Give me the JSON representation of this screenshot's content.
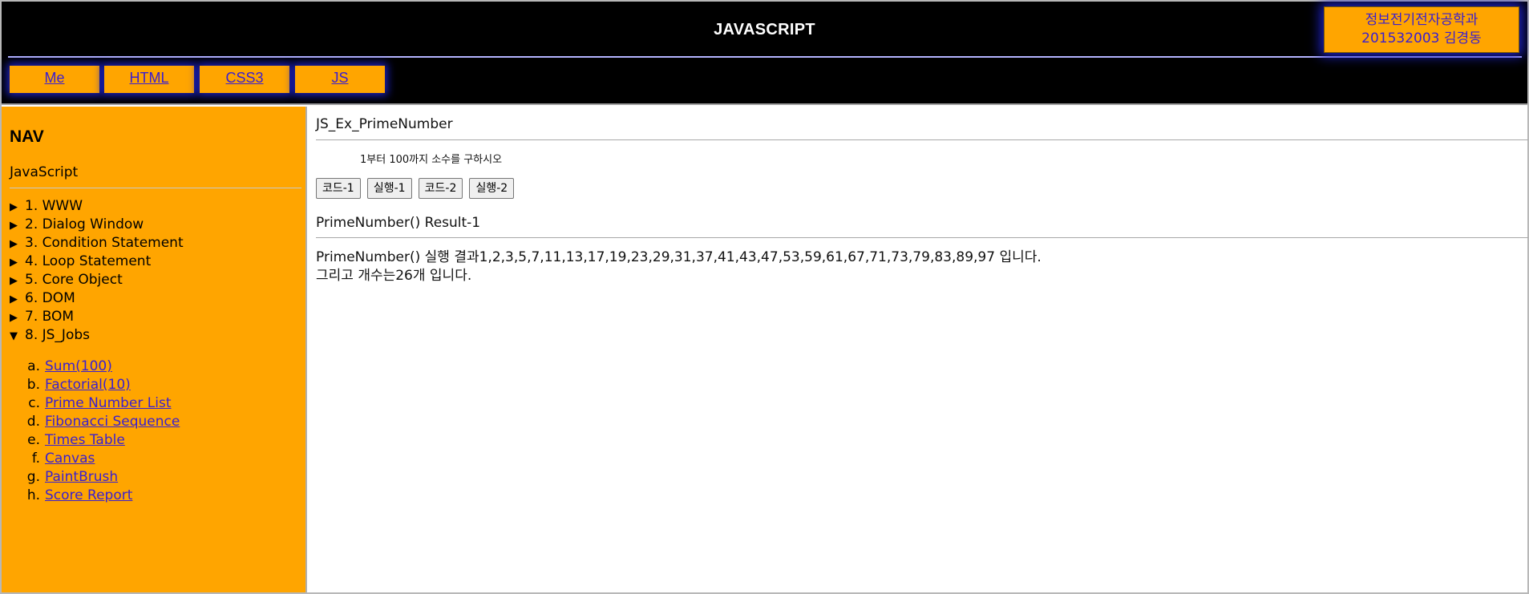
{
  "header": {
    "title": "JAVASCRIPT",
    "badge": {
      "line1": "정보전기전자공학과",
      "line2": "201532003 김경동"
    },
    "nav": [
      {
        "label": "Me"
      },
      {
        "label": "HTML"
      },
      {
        "label": "CSS3"
      },
      {
        "label": "JS"
      }
    ]
  },
  "sidebar": {
    "heading": "NAV",
    "subheading": "JavaScript",
    "chapters": [
      {
        "marker": "▶",
        "label": "1. WWW"
      },
      {
        "marker": "▶",
        "label": "2. Dialog Window"
      },
      {
        "marker": "▶",
        "label": "3. Condition Statement"
      },
      {
        "marker": "▶",
        "label": "4. Loop Statement"
      },
      {
        "marker": "▶",
        "label": "5. Core Object"
      },
      {
        "marker": "▶",
        "label": "6. DOM"
      },
      {
        "marker": "▶",
        "label": "7. BOM"
      },
      {
        "marker": "▼",
        "label": "8. JS_Jobs"
      }
    ],
    "jobs": [
      {
        "marker": "a.",
        "label": "Sum(100)"
      },
      {
        "marker": "b.",
        "label": "Factorial(10)"
      },
      {
        "marker": "c.",
        "label": "Prime Number List"
      },
      {
        "marker": "d.",
        "label": "Fibonacci Sequence"
      },
      {
        "marker": "e.",
        "label": "Times Table"
      },
      {
        "marker": "f.",
        "label": "Canvas"
      },
      {
        "marker": "g.",
        "label": "PaintBrush"
      },
      {
        "marker": "h.",
        "label": "Score Report"
      }
    ]
  },
  "main": {
    "section_title": "JS_Ex_PrimeNumber",
    "task": "1부터 100까지 소수를 구하시오",
    "buttons": [
      {
        "label": "코드-1"
      },
      {
        "label": "실행-1"
      },
      {
        "label": "코드-2"
      },
      {
        "label": "실행-2"
      }
    ],
    "result_title": "PrimeNumber() Result-1",
    "result_line1": "PrimeNumber() 실행 결과1,2,3,5,7,11,13,17,19,23,29,31,37,41,43,47,53,59,61,67,71,73,79,83,89,97 입니다.",
    "result_line2": "그리고 개수는26개 입니다."
  },
  "colors": {
    "header_bg": "#000000",
    "accent_orange": "#ffa500",
    "link_blue": "#3a1fd0",
    "glow_blue": "#1d22c8"
  }
}
